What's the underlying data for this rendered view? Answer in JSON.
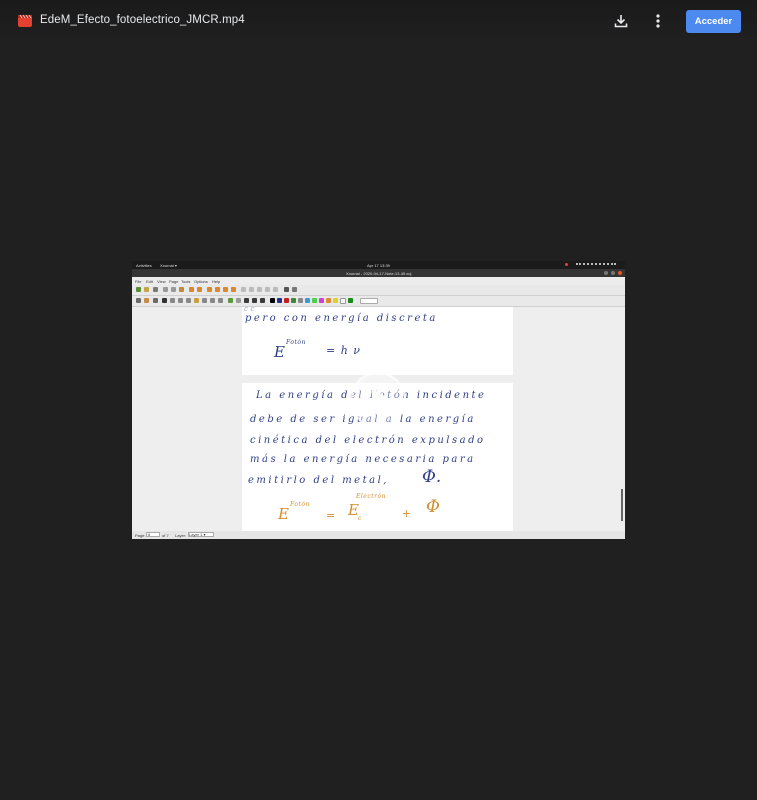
{
  "header": {
    "file_name": "EdeM_Efecto_fotoelectrico_JMCR.mp4",
    "file_icon": "video-file-icon",
    "download_icon": "download-icon",
    "more_icon": "more-vert-icon",
    "signin_label": "Acceder"
  },
  "colors": {
    "background": "#202020",
    "accent": "#4d8af0",
    "file_icon": "#e2412f",
    "ink_blue": "#2f3f86",
    "ink_orange": "#d38d2c"
  },
  "video": {
    "play_icon": "play-icon",
    "os_bar": {
      "activities": "Activities",
      "app": "Xournal ▾",
      "clock": "Apr 17 13:39"
    },
    "window_title": "Xournal - 2020-04-17-Note-13-45.xoj",
    "menu": [
      "File",
      "Edit",
      "View",
      "Page",
      "Tools",
      "Options",
      "Help"
    ],
    "status": {
      "page_label": "Page:",
      "page_value": "6",
      "of_pages": "of 7",
      "layer_label": "Layer:",
      "layer_value": "Layer 1 ▾",
      "zoom": "11"
    },
    "notes": {
      "line_1": "pero    con    energía    discreta",
      "eq_1_E": "E",
      "eq_1_sup": "Fotón",
      "eq_1_rhs": "=    h ν",
      "line_2": "La   energía   del   Fotón   incidente",
      "line_3": "debe   de   ser   igual   a   la   energía",
      "line_4": "cinética   del   electrón   expulsado",
      "line_5": "más   la   energía   necesaria   para",
      "line_6": "emitirlo   del   metal,",
      "phi": "Φ.",
      "eq_2_E": "E",
      "eq_2_sup": "Fotón",
      "eq_2_eq": "=",
      "eq_2_Ec": "E",
      "eq_2_c_sub": "c",
      "eq_2_c_sup": "Electrón",
      "eq_2_plus": "+",
      "eq_2_phi": "Φ"
    }
  }
}
